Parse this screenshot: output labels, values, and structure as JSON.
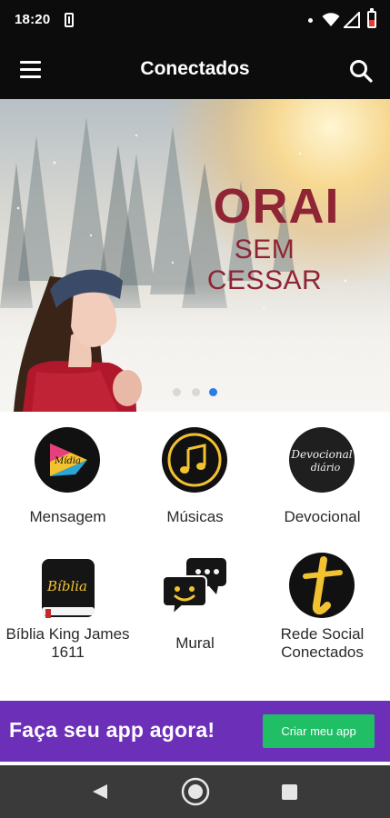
{
  "status_bar": {
    "time": "18:20",
    "icons": [
      "notification-icon",
      "dot-icon",
      "wifi-icon",
      "signal-icon",
      "battery-icon"
    ],
    "battery_color": "#e53935"
  },
  "app_bar": {
    "title": "Conectados",
    "menu_icon": "menu-icon",
    "search_icon": "search-icon",
    "background": "#0c0c0c"
  },
  "banner": {
    "title": "ORAI",
    "subtitle": "SEM CESSAR",
    "text_color": "#8e2434",
    "slide_count": 3,
    "active_slide": 3,
    "active_dot_color": "#2a7ce8"
  },
  "grid": {
    "items": [
      {
        "label": "Mensagem",
        "icon": "play-mensagem-icon"
      },
      {
        "label": "Músicas",
        "icon": "music-note-icon"
      },
      {
        "label": "Devocional",
        "icon": "devocional-diario-icon"
      },
      {
        "label": "Bíblia King James 1611",
        "icon": "bible-book-icon"
      },
      {
        "label": "Mural",
        "icon": "chat-bubbles-icon"
      },
      {
        "label": "Rede Social Conectados",
        "icon": "letter-t-icon"
      }
    ],
    "icon_text": {
      "mensagem": "Mídia",
      "devocional_line1": "Devocional",
      "devocional_line2": "diário",
      "biblia": "Bíblia"
    },
    "accent": "#f2c230"
  },
  "promo": {
    "text": "Faça seu app agora!",
    "button_label": "Criar meu app",
    "background": "#6c2fb8",
    "button_color": "#20bf66"
  },
  "nav_bar": {
    "buttons": [
      "back-icon",
      "home-icon",
      "recents-icon"
    ]
  }
}
